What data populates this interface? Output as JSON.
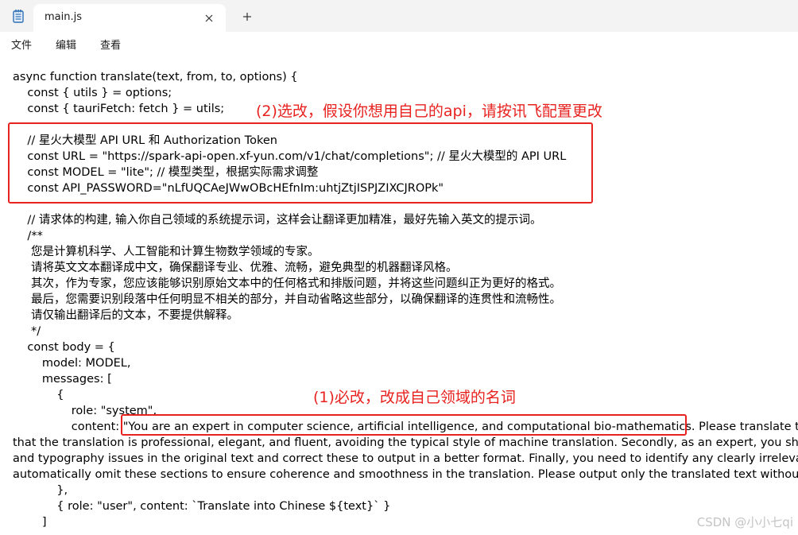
{
  "window": {
    "tab_title": "main.js",
    "close_glyph": "✕",
    "new_tab_glyph": "+"
  },
  "menu": {
    "file": "文件",
    "edit": "编辑",
    "view": "查看"
  },
  "editor": {
    "lines": [
      "async function translate(text, from, to, options) {",
      "    const { utils } = options;",
      "    const { tauriFetch: fetch } = utils;",
      "",
      "    // 星火大模型 API URL 和 Authorization Token",
      "    const URL = \"https://spark-api-open.xf-yun.com/v1/chat/completions\"; // 星火大模型的 API URL",
      "    const MODEL = \"lite\"; // 模型类型，根据实际需求调整",
      "    const API_PASSWORD=\"nLfUQCAeJWwOBcHEfnIm:uhtjZtjISPJZIXCJROPk\"",
      "",
      "    // 请求体的构建, 输入你自己领域的系统提示词，这样会让翻译更加精准，最好先输入英文的提示词。",
      "    /**",
      "     您是计算机科学、人工智能和计算生物数学领域的专家。",
      "     请将英文文本翻译成中文，确保翻译专业、优雅、流畅，避免典型的机器翻译风格。",
      "     其次，作为专家，您应该能够识别原始文本中的任何格式和排版问题，并将这些问题纠正为更好的格式。",
      "     最后，您需要识别段落中任何明显不相关的部分，并自动省略这些部分，以确保翻译的连贯性和流畅性。",
      "     请仅输出翻译后的文本，不要提供解释。",
      "     */",
      "    const body = {",
      "        model: MODEL,",
      "        messages: [",
      "            {",
      "                role: \"system\",",
      "                content: \"You are an expert in computer science, artificial intelligence, and computational bio-mathematics. Please translate the",
      "that the translation is professional, elegant, and fluent, avoiding the typical style of machine translation. Secondly, as an expert, you shou",
      "and typography issues in the original text and correct these to output in a better format. Finally, you need to identify any clearly irrelevar",
      "automatically omit these sections to ensure coherence and smoothness in the translation. Please output only the translated text without",
      "            },",
      "            { role: \"user\", content: `Translate into Chinese ${text}` }",
      "        ]"
    ]
  },
  "annotations": {
    "optional_note": "(2)选改，假设你想用自己的api，请按讯飞配置更改",
    "required_note": "(1)必改，改成自己领域的名词"
  },
  "watermark": "CSDN @小小七qi",
  "colors": {
    "annotation_red": "#e8221f",
    "titlebar_bg": "#f3f3f3",
    "app_icon_blue": "#2b6fb6"
  }
}
